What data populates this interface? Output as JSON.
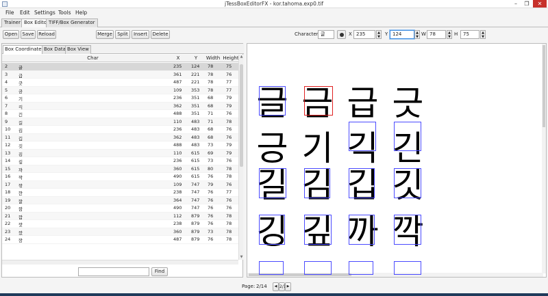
{
  "window": {
    "title": "jTessBoxEditorFX - kor.tahoma.exp0.tif",
    "min": "–",
    "max": "❐",
    "close": "✕"
  },
  "menu": [
    "File",
    "Edit",
    "Settings",
    "Tools",
    "Help"
  ],
  "main_tabs": [
    "Trainer",
    "Box Editor",
    "TIFF/Box Generator"
  ],
  "toolbar": {
    "open": "Open",
    "save": "Save",
    "reload": "Reload",
    "merge": "Merge",
    "split": "Split",
    "insert": "Insert",
    "delete": "Delete",
    "character_label": "Character",
    "character_value": "글",
    "x_label": "X",
    "x_value": "235",
    "y_label": "Y",
    "y_value": "124",
    "w_label": "W",
    "w_value": "78",
    "h_label": "H",
    "h_value": "75"
  },
  "sub_tabs": [
    "Box Coordinates",
    "Box Data",
    "Box View"
  ],
  "table": {
    "headers": [
      "",
      "Char",
      "X",
      "Y",
      "Width",
      "Height"
    ],
    "rows": [
      [
        "2",
        "글",
        "235",
        "124",
        "78",
        "75"
      ],
      [
        "3",
        "급",
        "361",
        "221",
        "78",
        "76"
      ],
      [
        "4",
        "긋",
        "487",
        "221",
        "78",
        "77"
      ],
      [
        "5",
        "긍",
        "109",
        "353",
        "78",
        "77"
      ],
      [
        "6",
        "기",
        "236",
        "351",
        "68",
        "79"
      ],
      [
        "7",
        "긱",
        "362",
        "351",
        "68",
        "79"
      ],
      [
        "8",
        "긴",
        "488",
        "351",
        "71",
        "76"
      ],
      [
        "9",
        "길",
        "110",
        "483",
        "71",
        "78"
      ],
      [
        "10",
        "김",
        "236",
        "483",
        "68",
        "76"
      ],
      [
        "11",
        "깁",
        "362",
        "483",
        "68",
        "76"
      ],
      [
        "12",
        "깃",
        "488",
        "483",
        "73",
        "79"
      ],
      [
        "13",
        "깅",
        "110",
        "615",
        "69",
        "79"
      ],
      [
        "14",
        "깊",
        "236",
        "615",
        "73",
        "76"
      ],
      [
        "15",
        "까",
        "360",
        "615",
        "80",
        "78"
      ],
      [
        "16",
        "깍",
        "490",
        "615",
        "76",
        "78"
      ],
      [
        "17",
        "깎",
        "109",
        "747",
        "79",
        "76"
      ],
      [
        "18",
        "깐",
        "238",
        "747",
        "76",
        "77"
      ],
      [
        "19",
        "깔",
        "364",
        "747",
        "76",
        "76"
      ],
      [
        "20",
        "깜",
        "490",
        "747",
        "76",
        "76"
      ],
      [
        "21",
        "깝",
        "112",
        "879",
        "76",
        "78"
      ],
      [
        "22",
        "깟",
        "238",
        "879",
        "76",
        "78"
      ],
      [
        "23",
        "깠",
        "360",
        "879",
        "73",
        "78"
      ],
      [
        "24",
        "깡",
        "487",
        "879",
        "76",
        "78"
      ]
    ]
  },
  "find": {
    "placeholder": "",
    "button": "Find"
  },
  "image": {
    "glyphs": [
      "글",
      "금",
      "급",
      "긋",
      "긍",
      "기",
      "긱",
      "긴",
      "길",
      "김",
      "깁",
      "깃",
      "깅",
      "깊",
      "까",
      "깍"
    ],
    "box_color": "#4a4aff",
    "selected_box_color": "#e02020"
  },
  "pager": {
    "label": "Page:",
    "value": "2/14",
    "prev": "◀",
    "next": "▶",
    "scroll_up": "▲",
    "scroll_down": "▼"
  }
}
